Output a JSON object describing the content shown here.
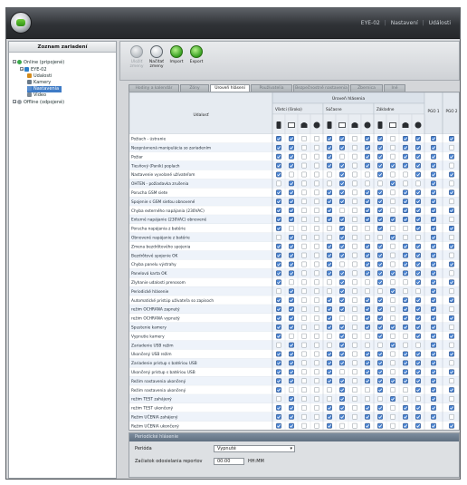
{
  "titlebar": {
    "device": "EYE-02",
    "sep": "|",
    "nastaveni": "Nastavení",
    "crumb": "Události"
  },
  "tree": {
    "header": "Zoznam zariadení",
    "nodes": [
      {
        "label": "Online (pripojené)",
        "depth": 0,
        "icon": "online-icon",
        "color": "#3aa84a"
      },
      {
        "label": "EYE-02",
        "depth": 1,
        "icon": "device-icon",
        "color": "#2d7fc9"
      },
      {
        "label": "Udalosti",
        "depth": 2,
        "icon": "events-icon",
        "color": "#d38b1c"
      },
      {
        "label": "Kamery",
        "depth": 2,
        "icon": "camera-icon",
        "color": "#6b7a88"
      },
      {
        "label": "Nastavenia",
        "depth": 2,
        "icon": "settings-icon",
        "color": "#5a8fd0",
        "selected": true
      },
      {
        "label": "Video",
        "depth": 2,
        "icon": "video-icon",
        "color": "#7b8894"
      },
      {
        "label": "Offline (odpojené)",
        "depth": 0,
        "icon": "offline-icon",
        "color": "#9aa0a6"
      }
    ]
  },
  "toolbar": {
    "buttons": [
      {
        "label": "Uložiť zmeny",
        "icon": "save-icon",
        "disabled": true
      },
      {
        "label": "Načítať zmeny",
        "icon": "reload-icon",
        "disabled": false
      },
      {
        "label": "Import",
        "icon": "import-icon",
        "disabled": false
      },
      {
        "label": "Export",
        "icon": "export-icon",
        "disabled": false
      }
    ]
  },
  "tabs": [
    {
      "label": "Hodiny a kalendár",
      "active": false
    },
    {
      "label": "Zóny",
      "active": false
    },
    {
      "label": "Úroveň hlásení",
      "active": true
    },
    {
      "label": "Používatelia",
      "active": false
    },
    {
      "label": "Bezpečnostné nastavenia",
      "active": false
    },
    {
      "label": "Zbernica",
      "active": false
    },
    {
      "label": "Iné",
      "active": false
    }
  ],
  "grid": {
    "group_header": "Úroveň hlásenia",
    "col_udalost": "Udalosť",
    "subgroups": [
      "Všetci (široko)",
      "Súčasne",
      "Základne"
    ],
    "pgo": [
      "PGO 1",
      "PGO 2"
    ],
    "rows": [
      "Požiach - ústranie",
      "Neoprávnená manipulácia so zariadením",
      "Požiar",
      "Tiesňový (Panik) poplach",
      "Nastavenie vyvolané užívateľom",
      "OHTEN - požiadavka zrušenia",
      "Porucha GSM siete",
      "Spojenie s GSM sieťou obnovené",
      "Chyba externého napájania (230VAC)",
      "Externé napájanie (230VAC) obnovené",
      "Porucha napájania z batérie",
      "Obnovené napájanie z batérie",
      "Zmena bezdrôtového spojenia",
      "Bezdrôtové spojenie OK",
      "Chyba panelu výstrahy",
      "Panelová karta OK",
      "Zlyhanie udalosti prenosom",
      "Periodické hlásenie",
      "Automatické pristúp užívateľa so zapisoch",
      "režim OCHRANA zapnutý",
      "režim OCHRANA vypnutý",
      "Spustenie kamery",
      "Vypnutie kamery",
      "Zariadenie USB režim",
      "Ukončený USB režim",
      "Zariadenie pristup s batériou USB",
      "Ukončený prístup s batériou USB",
      "Režim nastavenia ukončený",
      "Režim nastavenia ukončený",
      "režim TEST zahájený",
      "režim TEST ukončený",
      "Režim UČENIA zahájený",
      "Režim UČENIA ukončený"
    ]
  },
  "bottom": {
    "title": "Periodické hlásenie",
    "perioda_label": "Perióda",
    "perioda_value": "Vypnuté",
    "start_label": "Začiatok odosielania reportov",
    "start_value": "00:00",
    "start_unit": "HH:MM"
  },
  "colors": {
    "check_blue": "#4a86d6",
    "check_dark": "#1f3f73",
    "row_stripe": "#eef3fa",
    "header_bg": "#e6ebf1"
  }
}
